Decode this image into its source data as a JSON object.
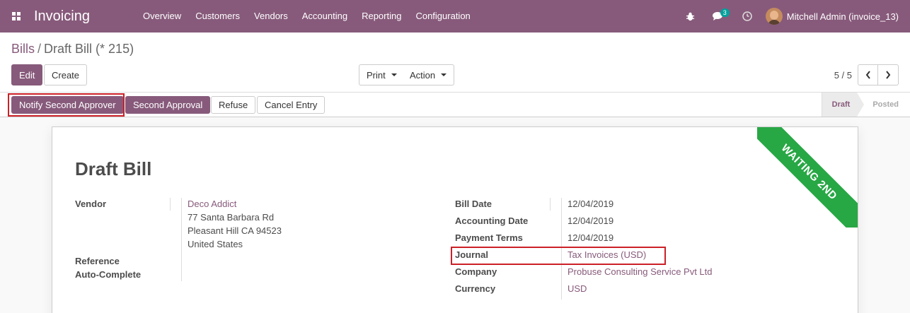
{
  "navbar": {
    "app_title": "Invoicing",
    "menu": [
      "Overview",
      "Customers",
      "Vendors",
      "Accounting",
      "Reporting",
      "Configuration"
    ],
    "messages_count": "3",
    "user_name": "Mitchell Admin (invoice_13)"
  },
  "breadcrumb": {
    "parent": "Bills",
    "current": "Draft Bill (* 215)"
  },
  "toolbar": {
    "edit_label": "Edit",
    "create_label": "Create",
    "print_label": "Print",
    "action_label": "Action",
    "pager_value": "5 / 5"
  },
  "statusbar": {
    "notify_label": "Notify Second Approver",
    "second_approval_label": "Second Approval",
    "refuse_label": "Refuse",
    "cancel_entry_label": "Cancel Entry",
    "stages": [
      "Draft",
      "Posted"
    ],
    "current_stage": "Draft"
  },
  "sheet": {
    "ribbon": "WAITING 2ND",
    "title": "Draft Bill",
    "vendor": {
      "label": "Vendor",
      "name": "Deco Addict",
      "address_line1": "77 Santa Barbara Rd",
      "address_line2": "Pleasant Hill CA 94523",
      "country": "United States"
    },
    "reference_label": "Reference Auto-Complete",
    "reference_label_line1": "Reference",
    "reference_label_line2": "Auto-Complete",
    "right_fields": [
      {
        "label": "Bill Date",
        "value": "12/04/2019"
      },
      {
        "label": "Accounting Date",
        "value": "12/04/2019"
      },
      {
        "label": "Payment Terms",
        "value": "12/04/2019"
      },
      {
        "label": "Journal",
        "value": "Tax Invoices (USD)"
      },
      {
        "label": "Company",
        "value": "Probuse Consulting Service Pvt Ltd"
      },
      {
        "label": "Currency",
        "value": "USD"
      }
    ]
  },
  "colors": {
    "brand": "#875a7b",
    "ribbon": "#28a745",
    "highlight": "#cc2027",
    "badge": "#00a09d"
  }
}
